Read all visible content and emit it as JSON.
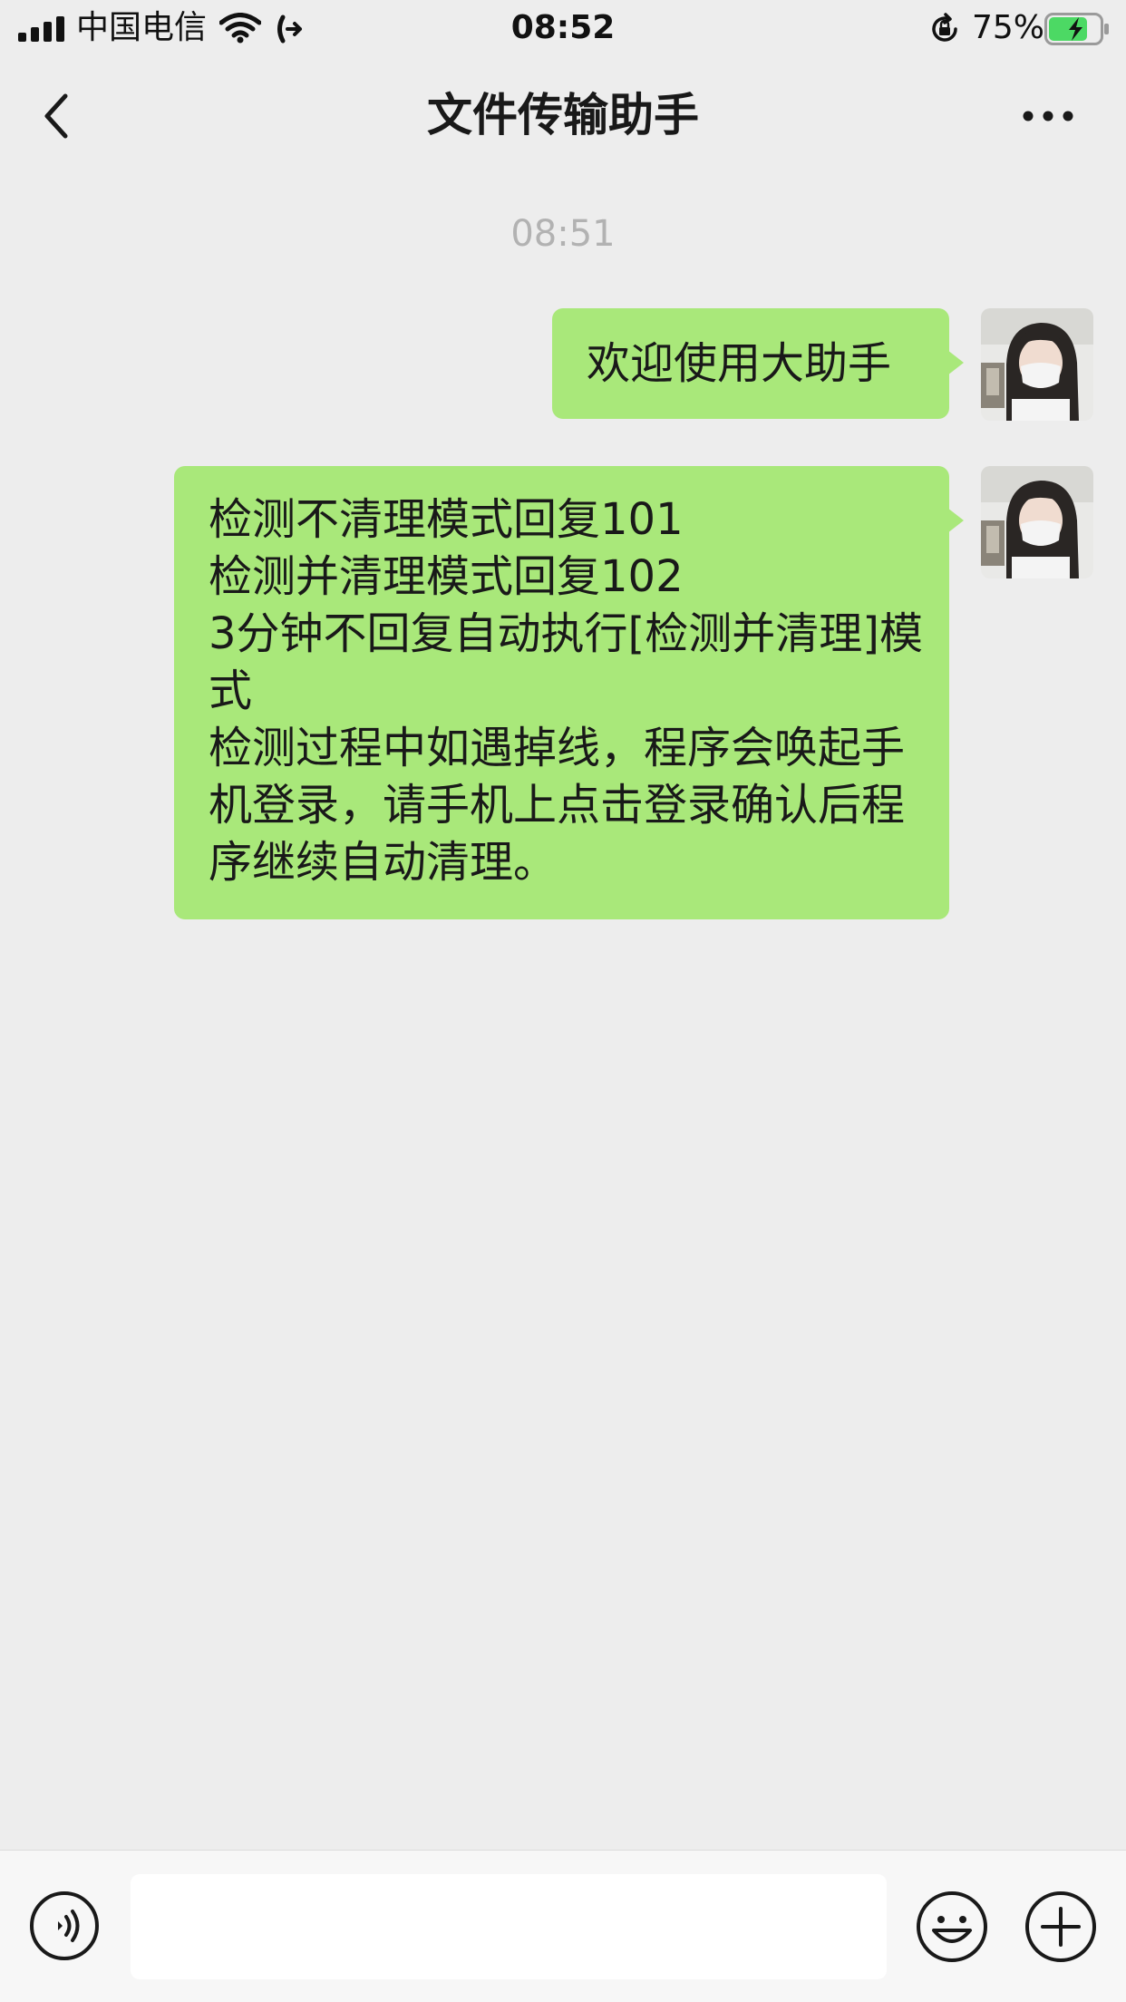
{
  "status_bar": {
    "carrier": "中国电信",
    "time": "08:52",
    "battery_percent": "75%",
    "battery_level": 0.75,
    "signal_bars": 4
  },
  "nav": {
    "title": "文件传输助手",
    "back_icon": "chevron-left-icon",
    "more_icon": "more-dots-icon"
  },
  "chat": {
    "timestamp": "08:51",
    "messages": [
      {
        "sender": "me",
        "text": "欢迎使用大助手"
      },
      {
        "sender": "me",
        "text": "检测不清理模式回复101\n检测并清理模式回复102\n3分钟不回复自动执行[检测并清理]模式\n检测过程中如遇掉线，程序会唤起手机登录，请手机上点击登录确认后程序继续自动清理。"
      }
    ]
  },
  "input_bar": {
    "value": "",
    "placeholder": "",
    "voice_icon": "voice-icon",
    "emoji_icon": "emoji-icon",
    "plus_icon": "plus-icon"
  },
  "colors": {
    "background": "#ededed",
    "bubble": "#a9e87a",
    "timestamp": "#b2b2b2",
    "input_bar": "#f7f7f7",
    "battery": "#4cd964"
  }
}
